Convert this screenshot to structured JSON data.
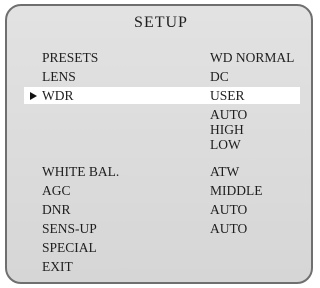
{
  "menu": {
    "title": "SETUP",
    "selected_index": 2,
    "items": [
      {
        "label": "PRESETS",
        "value": "WD NORMAL"
      },
      {
        "label": "LENS",
        "value": "DC"
      },
      {
        "label": "WDR",
        "value": "USER"
      },
      {
        "label": "",
        "value": "AUTO"
      },
      {
        "label": "",
        "value": "HIGH"
      },
      {
        "label": "",
        "value": "LOW"
      },
      {
        "label": "WHITE BAL.",
        "value": "ATW"
      },
      {
        "label": "AGC",
        "value": "MIDDLE"
      },
      {
        "label": "DNR",
        "value": "AUTO"
      },
      {
        "label": "SENS-UP",
        "value": "AUTO"
      },
      {
        "label": "SPECIAL",
        "value": ""
      },
      {
        "label": "EXIT",
        "value": ""
      }
    ]
  }
}
